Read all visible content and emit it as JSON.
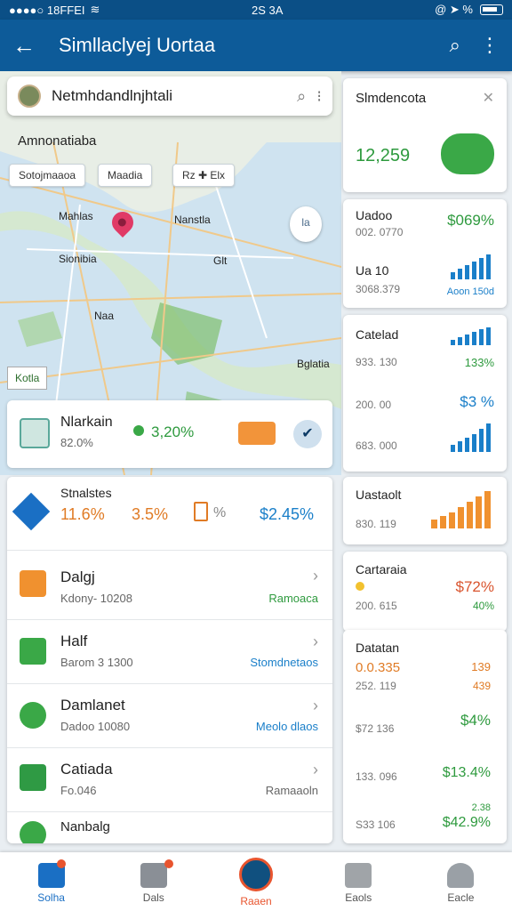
{
  "status": {
    "left": "●●●●○ 18FFEI",
    "time": "2S 3A",
    "right": "@ ➤ %"
  },
  "appbar": {
    "title": "Simllaclyej Uortaa"
  },
  "map": {
    "search_text": "Netmhdandlnjhtali",
    "area_title": "Amnonatiaba",
    "chips": [
      "Sotojmaaoa",
      "Maadia",
      "Rz ✚ Elx"
    ],
    "labels": [
      "Mahlas",
      "Nanstla",
      "Sionibia",
      "Bglatia",
      "Naa",
      "Glt"
    ],
    "bubble_text": "la",
    "tag": "Kotla"
  },
  "right": {
    "c1": {
      "title": "Slmdencota",
      "value": "12,259"
    },
    "c2": {
      "r1_title": "Uadoo",
      "r1_sub": "002. 0770",
      "r1_val": "$069%",
      "r2_title": "Ua 10",
      "r2_sub": "3068.379",
      "r2_val": "Aoon 150d"
    },
    "c3": {
      "title": "Catelad",
      "r1_sub": "933. 130",
      "r1_val": "133%",
      "r2_title": "200. 00",
      "r2_val": "$3 %",
      "r3_sub": "683. 000"
    },
    "c4": {
      "title": "Uastaolt",
      "sub": "830. 119"
    },
    "c5": {
      "title": "Cartaraia",
      "r1_sub": "200. 615",
      "r1_val": "$72%",
      "r1_val2": "40%"
    },
    "c6": {
      "title": "Datatan",
      "r1_val": "0.0.335",
      "r1_sub": "252. 119",
      "r1_val2": "139",
      "r1_val3": "439",
      "r2_val": "$4%",
      "r2_sub": "$72 136",
      "r3_sub": "133. 096",
      "r3_val": "$13.4%",
      "r4_sub": "S33 106",
      "r4_val": "$42.9%",
      "r4_val2": "2.38"
    }
  },
  "summary": {
    "title": "Nlarkain",
    "sub": "82.0%",
    "value": "3,20%"
  },
  "stats": {
    "title": "Stnalstes",
    "v1": "11.6%",
    "v2": "3.5%",
    "v3": "%",
    "v4": "$2.45%"
  },
  "rows": [
    {
      "name": "Dalgj",
      "sub": "Kdony- 10208",
      "val": "Ramoaca"
    },
    {
      "name": "Half",
      "sub": "Barom 3 1300",
      "val": "Stomdnetaos"
    },
    {
      "name": "Damlanet",
      "sub": "Dadoo  10080",
      "val": "Meolo dlaos"
    },
    {
      "name": "Catiada",
      "sub": "Fo.046",
      "val": "Ramaaoln"
    },
    {
      "name": "Nanbalg",
      "sub": "",
      "val": ""
    }
  ],
  "bnav": [
    {
      "label": "Solha",
      "icon": "home-icon"
    },
    {
      "label": "Dals",
      "icon": "calendar-icon"
    },
    {
      "label": "Raaen",
      "icon": "center-action-icon"
    },
    {
      "label": "Eaols",
      "icon": "bag-icon"
    },
    {
      "label": "Eacle",
      "icon": "profile-icon"
    }
  ],
  "colors": {
    "primary": "#0d5b99",
    "green": "#2e9a3e",
    "blue": "#1a7fc9",
    "orange": "#e07b25"
  }
}
